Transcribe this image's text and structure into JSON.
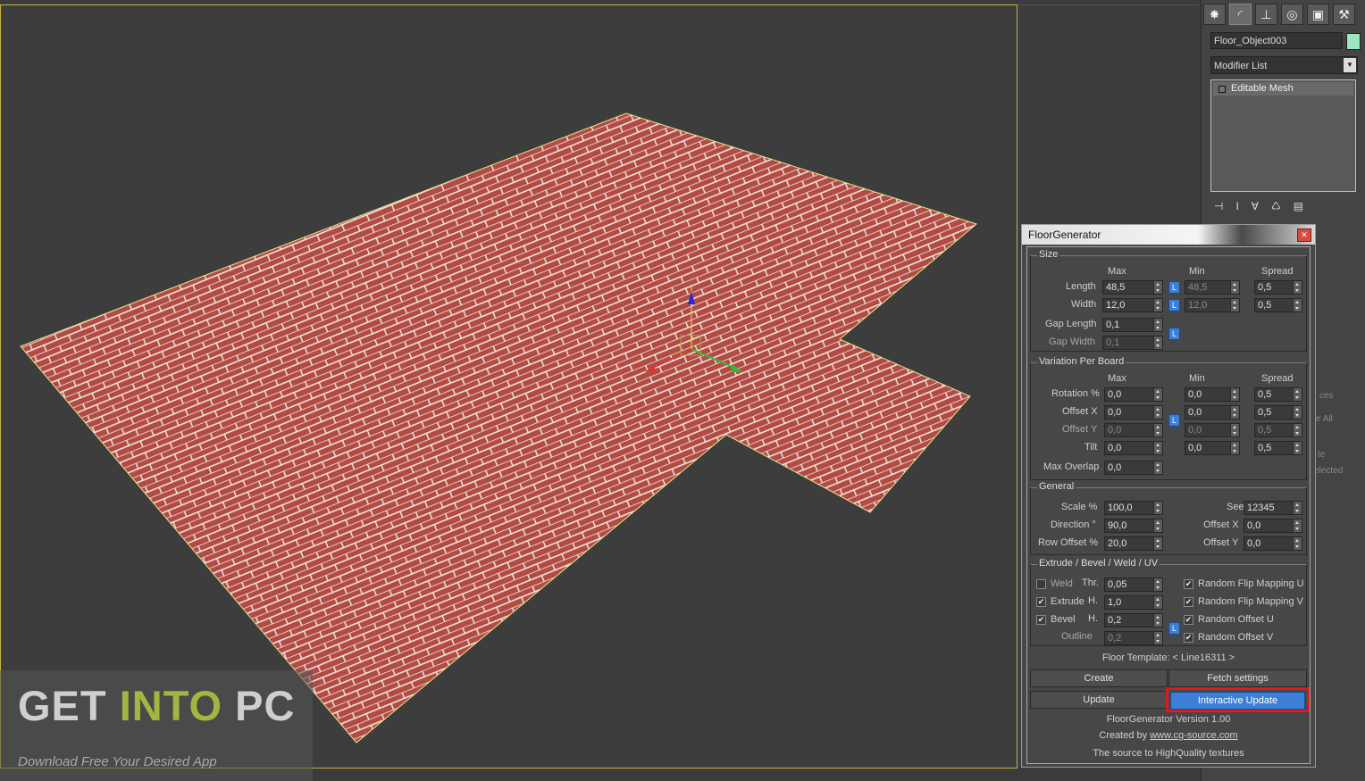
{
  "command_panel": {
    "tabs": [
      {
        "icon": "create-icon",
        "glyph": "✸"
      },
      {
        "icon": "modify-icon",
        "glyph": "◜"
      },
      {
        "icon": "hierarchy-icon",
        "glyph": "⊥"
      },
      {
        "icon": "motion-icon",
        "glyph": "◎"
      },
      {
        "icon": "display-icon",
        "glyph": "▣"
      },
      {
        "icon": "utilities-icon",
        "glyph": "⚒"
      }
    ],
    "object_name": "Floor_Object003",
    "object_color": "#9ee6c0",
    "modifier_list": "Modifier List",
    "stack_items": [
      "Editable Mesh"
    ],
    "ghost_texts": [
      "ces",
      "e All",
      "te",
      "elected"
    ]
  },
  "dialog": {
    "title": "FloorGenerator",
    "size": {
      "title": "Size",
      "col_max": "Max",
      "col_min": "Min",
      "col_spread": "Spread",
      "length_label": "Length",
      "length_max": "48,5",
      "length_min": "48,5",
      "length_spread": "0,5",
      "width_label": "Width",
      "width_max": "12,0",
      "width_min": "12,0",
      "width_spread": "0,5",
      "gap_length_label": "Gap Length",
      "gap_length": "0,1",
      "gap_width_label": "Gap Width",
      "gap_width": "0,1",
      "lock": "L"
    },
    "variation": {
      "title": "Variation Per Board",
      "col_max": "Max",
      "col_min": "Min",
      "col_spread": "Spread",
      "rotation_label": "Rotation %",
      "rotation_max": "0,0",
      "rotation_min": "0,0",
      "rotation_spread": "0,5",
      "offsetx_label": "Offset X",
      "offsetx_max": "0,0",
      "offsetx_min": "0,0",
      "offsetx_spread": "0,5",
      "offsety_label": "Offset Y",
      "offsety_max": "0,0",
      "offsety_min": "0,0",
      "offsety_spread": "0,5",
      "tilt_label": "Tilt",
      "tilt_max": "0,0",
      "tilt_min": "0,0",
      "tilt_spread": "0,5",
      "maxoverlap_label": "Max Overlap",
      "maxoverlap": "0,0",
      "lock": "L"
    },
    "general": {
      "title": "General",
      "scale_label": "Scale %",
      "scale": "100,0",
      "direction_label": "Direction °",
      "direction": "90,0",
      "rowoffset_label": "Row Offset %",
      "rowoffset": "20,0",
      "seed_label": "Seed",
      "seed": "12345",
      "offsetx_label": "Offset X",
      "offsetx": "0,0",
      "offsety_label": "Offset Y",
      "offsety": "0,0"
    },
    "extrude": {
      "title": "Extrude / Bevel / Weld / UV",
      "weld_label": "Weld",
      "weld_checked": false,
      "thr_label": "Thr.",
      "thr": "0,05",
      "extrude_label": "Extrude",
      "extrude_checked": true,
      "extrude_h_label": "H.",
      "extrude_h": "1,0",
      "bevel_label": "Bevel",
      "bevel_checked": true,
      "bevel_h_label": "H.",
      "bevel_h": "0,2",
      "outline_label": "Outline",
      "outline": "0,2",
      "flip_u_label": "Random Flip Mapping U",
      "flip_v_label": "Random Flip Mapping V",
      "offset_u_label": "Random Offset U",
      "offset_v_label": "Random Offset V",
      "lock": "L",
      "check_mark": "✔"
    },
    "floor_template": "Floor Template: < Line16311 >",
    "buttons": {
      "create": "Create",
      "fetch": "Fetch settings",
      "update": "Update",
      "interactive_update": "Interactive Update"
    },
    "footer": {
      "version": "FloorGenerator Version 1.00",
      "created_by": "Created by",
      "created_link": "www.cg-source.com",
      "tagline": "The source to HighQuality textures"
    }
  },
  "watermark": {
    "get": "GET",
    "into": "INTO",
    "pc": "PC",
    "subtitle": "Download Free Your Desired App"
  },
  "colors": {
    "floor_tile": "#b34b45",
    "grout": "#f2efe6",
    "viewport_border": "#c8b33c",
    "highlight": "#e01a1a",
    "accent_blue": "#3d7fd6"
  }
}
